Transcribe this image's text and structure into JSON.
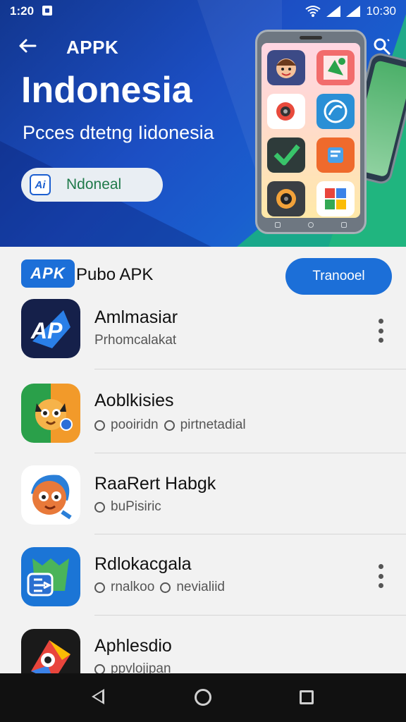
{
  "status_bar": {
    "time_left": "1:20",
    "time_right": "10:30"
  },
  "header": {
    "title": "APPK"
  },
  "hero": {
    "title": "Indonesia",
    "subtitle": "Pcces dtetng Iidonesia",
    "chip": {
      "logo_text": "Ai",
      "label": "Ndoneal"
    }
  },
  "featured": {
    "logo_text": "APK",
    "title": "Pubo APK",
    "button_label": "Tranooel"
  },
  "apps": [
    {
      "name": "Amlmasiar",
      "meta": [
        "Prhomcalakat"
      ],
      "has_menu": true,
      "icon": "ap-logo-icon"
    },
    {
      "name": "Aoblkisies",
      "meta": [
        "pooiridn",
        "pirtnetadial"
      ],
      "has_menu": false,
      "icon": "owl-mascot-icon"
    },
    {
      "name": "RaaRert Habgk",
      "meta": [
        "buPisiric"
      ],
      "has_menu": false,
      "icon": "cartoon-character-icon"
    },
    {
      "name": "Rdlokacgala",
      "meta": [
        "rnalkoo",
        "nevialiid"
      ],
      "has_menu": true,
      "icon": "green-blob-arrow-icon"
    },
    {
      "name": "Aphlesdio",
      "meta": [
        "ppvlojipan"
      ],
      "has_menu": false,
      "icon": "colorful-bird-icon"
    }
  ],
  "colors": {
    "accent": "#1c6fd8",
    "hero_dark": "#12368f",
    "hero_green": "#22b77c"
  }
}
